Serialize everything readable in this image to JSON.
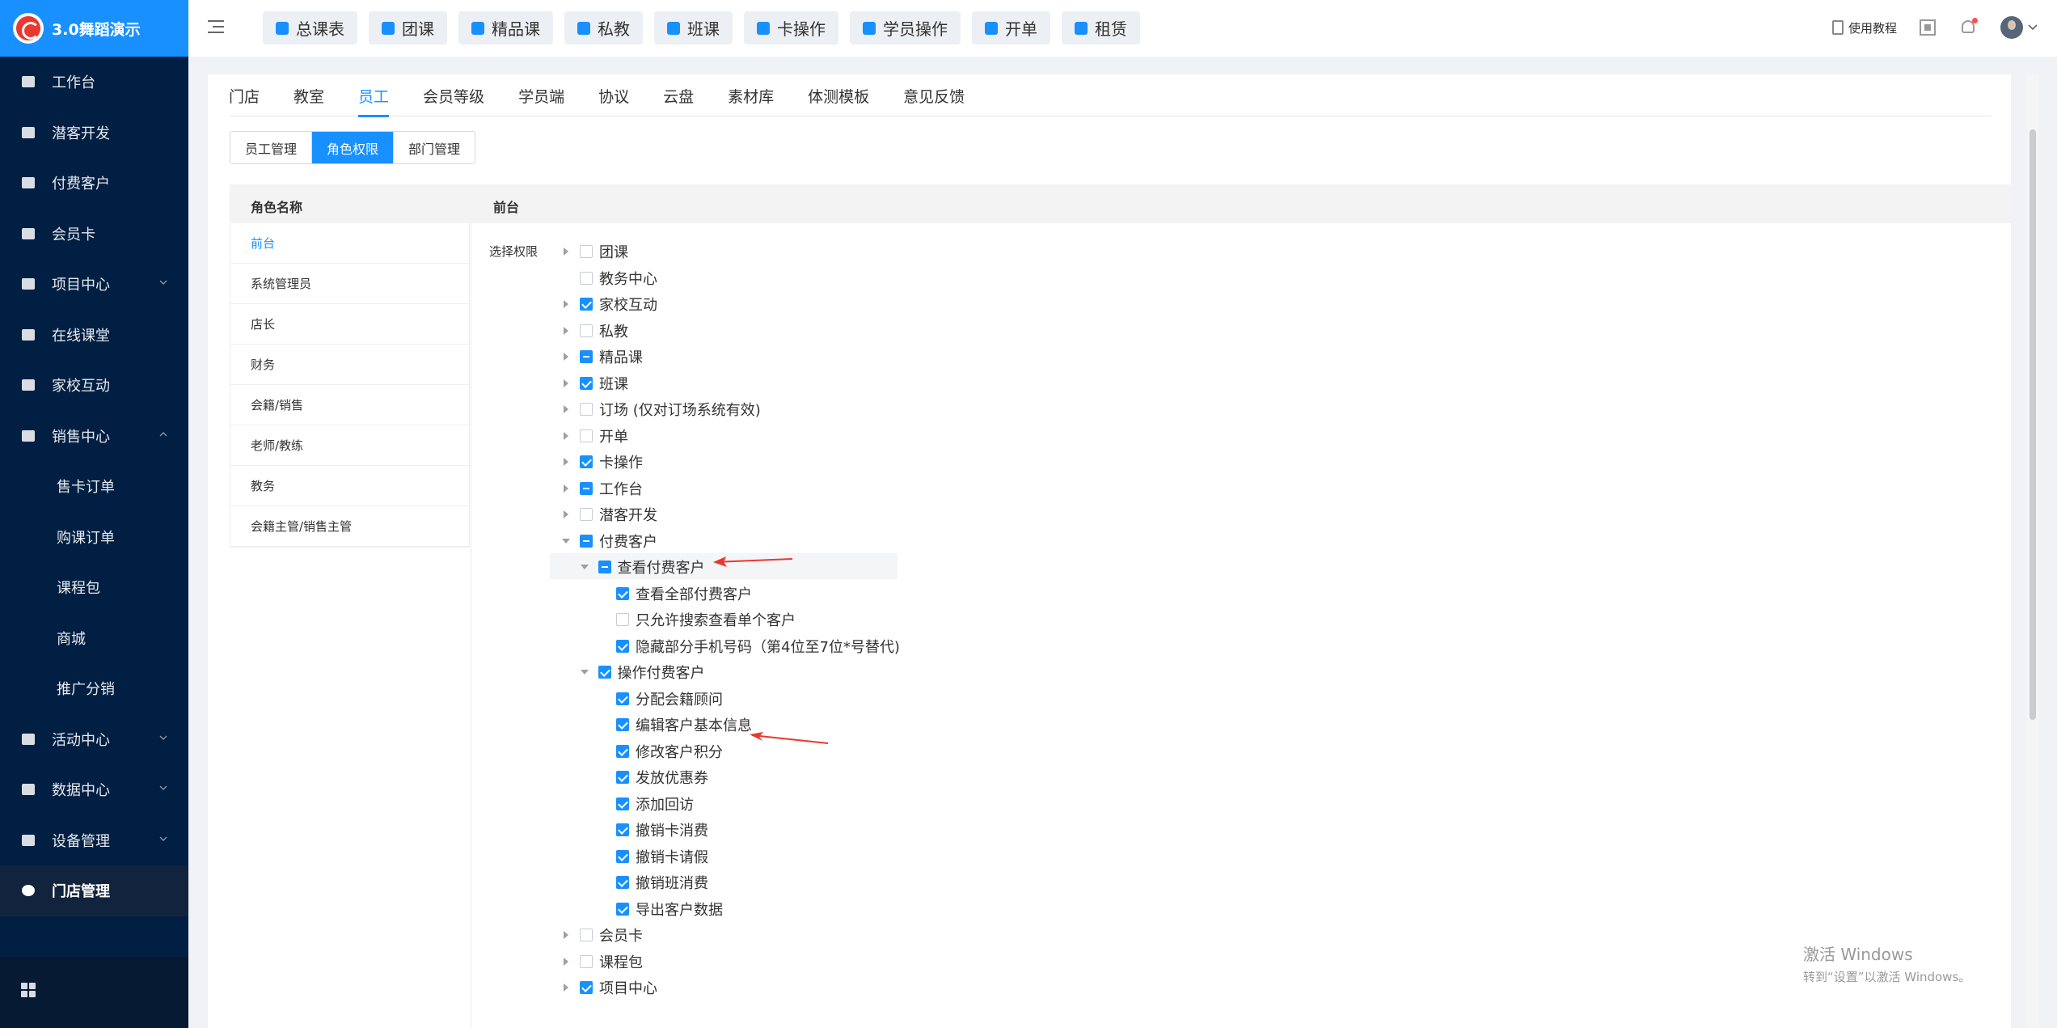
{
  "app": {
    "logo_text": "3.0舞蹈演示"
  },
  "sidebar": {
    "items": [
      {
        "label": "工作台",
        "icon": "dashboard-icon"
      },
      {
        "label": "潜客开发",
        "icon": "contact-card-icon"
      },
      {
        "label": "付费客户",
        "icon": "users-icon"
      },
      {
        "label": "会员卡",
        "icon": "card-icon"
      },
      {
        "label": "项目中心",
        "icon": "project-icon",
        "expandable": true
      },
      {
        "label": "在线课堂",
        "icon": "classroom-icon"
      },
      {
        "label": "家校互动",
        "icon": "interaction-icon"
      },
      {
        "label": "销售中心",
        "icon": "tag-icon",
        "expanded": true
      },
      {
        "label": "售卡订单",
        "sub": true
      },
      {
        "label": "购课订单",
        "sub": true
      },
      {
        "label": "课程包",
        "sub": true
      },
      {
        "label": "商城",
        "sub": true
      },
      {
        "label": "推广分销",
        "sub": true
      },
      {
        "label": "活动中心",
        "icon": "activity-icon",
        "expandable": true
      },
      {
        "label": "数据中心",
        "icon": "pie-chart-icon",
        "expandable": true
      },
      {
        "label": "设备管理",
        "icon": "device-icon",
        "expandable": true
      },
      {
        "label": "门店管理",
        "icon": "store-icon",
        "active": true
      }
    ]
  },
  "toptabs": [
    "总课表",
    "团课",
    "精品课",
    "私教",
    "班课",
    "卡操作",
    "学员操作",
    "开单",
    "租赁"
  ],
  "topright": {
    "help_label": "使用教程"
  },
  "navtabs": [
    "门店",
    "教室",
    "员工",
    "会员等级",
    "学员端",
    "协议",
    "云盘",
    "素材库",
    "体测模板",
    "意见反馈"
  ],
  "navtabs_active": "员工",
  "segments": [
    "员工管理",
    "角色权限",
    "部门管理"
  ],
  "segments_active": "角色权限",
  "table": {
    "col_role": "角色名称",
    "col_perm": "前台"
  },
  "roles": [
    "前台",
    "系统管理员",
    "店长",
    "财务",
    "会籍/销售",
    "老师/教练",
    "教务",
    "会籍主管/销售主管"
  ],
  "perm_label": "选择权限",
  "tree": [
    {
      "label": "团课",
      "level": 0,
      "caret": "right",
      "state": "none"
    },
    {
      "label": "教务中心",
      "level": 0,
      "caret": "",
      "state": "none"
    },
    {
      "label": "家校互动",
      "level": 0,
      "caret": "right",
      "state": "checked"
    },
    {
      "label": "私教",
      "level": 0,
      "caret": "right",
      "state": "none"
    },
    {
      "label": "精品课",
      "level": 0,
      "caret": "right",
      "state": "half"
    },
    {
      "label": "班课",
      "level": 0,
      "caret": "right",
      "state": "checked"
    },
    {
      "label": "订场 (仅对订场系统有效)",
      "level": 0,
      "caret": "right",
      "state": "none"
    },
    {
      "label": "开单",
      "level": 0,
      "caret": "right",
      "state": "none"
    },
    {
      "label": "卡操作",
      "level": 0,
      "caret": "right",
      "state": "checked"
    },
    {
      "label": "工作台",
      "level": 0,
      "caret": "right",
      "state": "half"
    },
    {
      "label": "潜客开发",
      "level": 0,
      "caret": "right",
      "state": "none"
    },
    {
      "label": "付费客户",
      "level": 0,
      "caret": "down",
      "state": "half"
    },
    {
      "label": "查看付费客户",
      "level": 1,
      "caret": "down",
      "state": "half"
    },
    {
      "label": "查看全部付费客户",
      "level": 2,
      "caret": "",
      "state": "checked"
    },
    {
      "label": "只允许搜索查看单个客户",
      "level": 2,
      "caret": "",
      "state": "none"
    },
    {
      "label": "隐藏部分手机号码（第4位至7位*号替代)",
      "level": 2,
      "caret": "",
      "state": "checked"
    },
    {
      "label": "操作付费客户",
      "level": 1,
      "caret": "down",
      "state": "checked"
    },
    {
      "label": "分配会籍顾问",
      "level": 2,
      "caret": "",
      "state": "checked"
    },
    {
      "label": "编辑客户基本信息",
      "level": 2,
      "caret": "",
      "state": "checked"
    },
    {
      "label": "修改客户积分",
      "level": 2,
      "caret": "",
      "state": "checked"
    },
    {
      "label": "发放优惠券",
      "level": 2,
      "caret": "",
      "state": "checked"
    },
    {
      "label": "添加回访",
      "level": 2,
      "caret": "",
      "state": "checked"
    },
    {
      "label": "撤销卡消费",
      "level": 2,
      "caret": "",
      "state": "checked"
    },
    {
      "label": "撤销卡请假",
      "level": 2,
      "caret": "",
      "state": "checked"
    },
    {
      "label": "撤销班消费",
      "level": 2,
      "caret": "",
      "state": "checked"
    },
    {
      "label": "导出客户数据",
      "level": 2,
      "caret": "",
      "state": "checked"
    },
    {
      "label": "会员卡",
      "level": 0,
      "caret": "right",
      "state": "none"
    },
    {
      "label": "课程包",
      "level": 0,
      "caret": "right",
      "state": "none"
    },
    {
      "label": "项目中心",
      "level": 0,
      "caret": "right",
      "state": "checked"
    }
  ],
  "watermark": {
    "line1": "激活 Windows",
    "line2": "转到“设置”以激活 Windows。"
  },
  "colors": {
    "sidebar": "#001f42",
    "accent": "#1890ff",
    "arrow": "#e8382f"
  }
}
